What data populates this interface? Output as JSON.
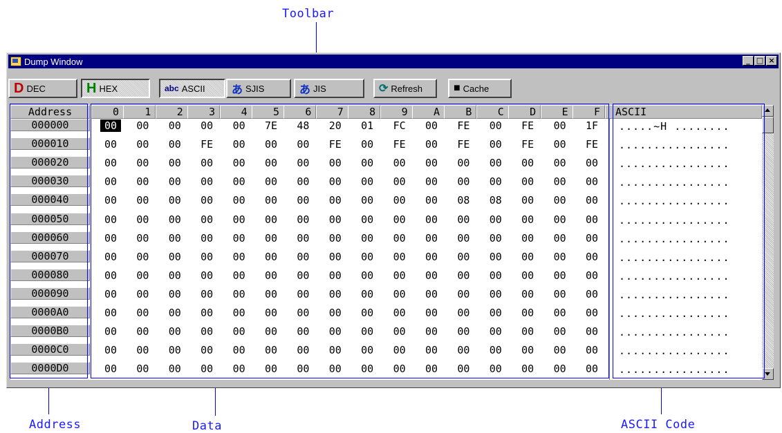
{
  "callouts": {
    "toolbar": "Toolbar",
    "address": "Address",
    "data": "Data",
    "ascii_code": "ASCII Code"
  },
  "window": {
    "title": "Dump Window",
    "minimize": "_",
    "maximize": "□",
    "close": "×"
  },
  "toolbar": [
    {
      "id": "dec",
      "glyph": "D",
      "glyph_color": "#c00000",
      "label": "DEC",
      "pressed": false
    },
    {
      "id": "hex",
      "glyph": "H",
      "glyph_color": "#008000",
      "label": "HEX",
      "pressed": true
    },
    {
      "id": "ascii",
      "glyph": "abc",
      "glyph_color": "#000080",
      "label": "ASCII",
      "pressed": true
    },
    {
      "id": "sjis",
      "glyph": "あ",
      "glyph_color": "#1030c0",
      "label": "SJIS",
      "pressed": false
    },
    {
      "id": "jis",
      "glyph": "あ",
      "glyph_color": "#1030c0",
      "label": "JIS",
      "pressed": false
    },
    {
      "id": "refresh",
      "glyph": "⟳",
      "glyph_color": "#007070",
      "label": "Refresh",
      "pressed": false
    },
    {
      "id": "cache",
      "glyph": "■",
      "glyph_color": "#000000",
      "label": "Cache",
      "pressed": false
    }
  ],
  "dump": {
    "address_header": "Address",
    "column_headers": [
      "0",
      "1",
      "2",
      "3",
      "4",
      "5",
      "6",
      "7",
      "8",
      "9",
      "A",
      "B",
      "C",
      "D",
      "E",
      "F"
    ],
    "ascii_header": "ASCII",
    "selected_cell": "000000:0",
    "rows": [
      {
        "address": "000000",
        "bytes": [
          "00",
          "00",
          "00",
          "00",
          "00",
          "7E",
          "48",
          "20",
          "01",
          "FC",
          "00",
          "FE",
          "00",
          "FE",
          "00",
          "1F"
        ],
        "ascii": ".....~H ........"
      },
      {
        "address": "000010",
        "bytes": [
          "00",
          "00",
          "00",
          "FE",
          "00",
          "00",
          "00",
          "FE",
          "00",
          "FE",
          "00",
          "FE",
          "00",
          "FE",
          "00",
          "FE"
        ],
        "ascii": "................"
      },
      {
        "address": "000020",
        "bytes": [
          "00",
          "00",
          "00",
          "00",
          "00",
          "00",
          "00",
          "00",
          "00",
          "00",
          "00",
          "00",
          "00",
          "00",
          "00",
          "00"
        ],
        "ascii": "................"
      },
      {
        "address": "000030",
        "bytes": [
          "00",
          "00",
          "00",
          "00",
          "00",
          "00",
          "00",
          "00",
          "00",
          "00",
          "00",
          "00",
          "00",
          "00",
          "00",
          "00"
        ],
        "ascii": "................"
      },
      {
        "address": "000040",
        "bytes": [
          "00",
          "00",
          "00",
          "00",
          "00",
          "00",
          "00",
          "00",
          "00",
          "00",
          "00",
          "08",
          "08",
          "00",
          "00",
          "00"
        ],
        "ascii": "................"
      },
      {
        "address": "000050",
        "bytes": [
          "00",
          "00",
          "00",
          "00",
          "00",
          "00",
          "00",
          "00",
          "00",
          "00",
          "00",
          "00",
          "00",
          "00",
          "00",
          "00"
        ],
        "ascii": "................"
      },
      {
        "address": "000060",
        "bytes": [
          "00",
          "00",
          "00",
          "00",
          "00",
          "00",
          "00",
          "00",
          "00",
          "00",
          "00",
          "00",
          "00",
          "00",
          "00",
          "00"
        ],
        "ascii": "................"
      },
      {
        "address": "000070",
        "bytes": [
          "00",
          "00",
          "00",
          "00",
          "00",
          "00",
          "00",
          "00",
          "00",
          "00",
          "00",
          "00",
          "00",
          "00",
          "00",
          "00"
        ],
        "ascii": "................"
      },
      {
        "address": "000080",
        "bytes": [
          "00",
          "00",
          "00",
          "00",
          "00",
          "00",
          "00",
          "00",
          "00",
          "00",
          "00",
          "00",
          "00",
          "00",
          "00",
          "00"
        ],
        "ascii": "................"
      },
      {
        "address": "000090",
        "bytes": [
          "00",
          "00",
          "00",
          "00",
          "00",
          "00",
          "00",
          "00",
          "00",
          "00",
          "00",
          "00",
          "00",
          "00",
          "00",
          "00"
        ],
        "ascii": "................"
      },
      {
        "address": "0000A0",
        "bytes": [
          "00",
          "00",
          "00",
          "00",
          "00",
          "00",
          "00",
          "00",
          "00",
          "00",
          "00",
          "00",
          "00",
          "00",
          "00",
          "00"
        ],
        "ascii": "................"
      },
      {
        "address": "0000B0",
        "bytes": [
          "00",
          "00",
          "00",
          "00",
          "00",
          "00",
          "00",
          "00",
          "00",
          "00",
          "00",
          "00",
          "00",
          "00",
          "00",
          "00"
        ],
        "ascii": "................"
      },
      {
        "address": "0000C0",
        "bytes": [
          "00",
          "00",
          "00",
          "00",
          "00",
          "00",
          "00",
          "00",
          "00",
          "00",
          "00",
          "00",
          "00",
          "00",
          "00",
          "00"
        ],
        "ascii": "................"
      },
      {
        "address": "0000D0",
        "bytes": [
          "00",
          "00",
          "00",
          "00",
          "00",
          "00",
          "00",
          "00",
          "00",
          "00",
          "00",
          "00",
          "00",
          "00",
          "00",
          "00"
        ],
        "ascii": "................"
      }
    ]
  },
  "scrollbar": {
    "up_icon": "triangle-up-icon",
    "down_icon": "triangle-down-icon"
  }
}
